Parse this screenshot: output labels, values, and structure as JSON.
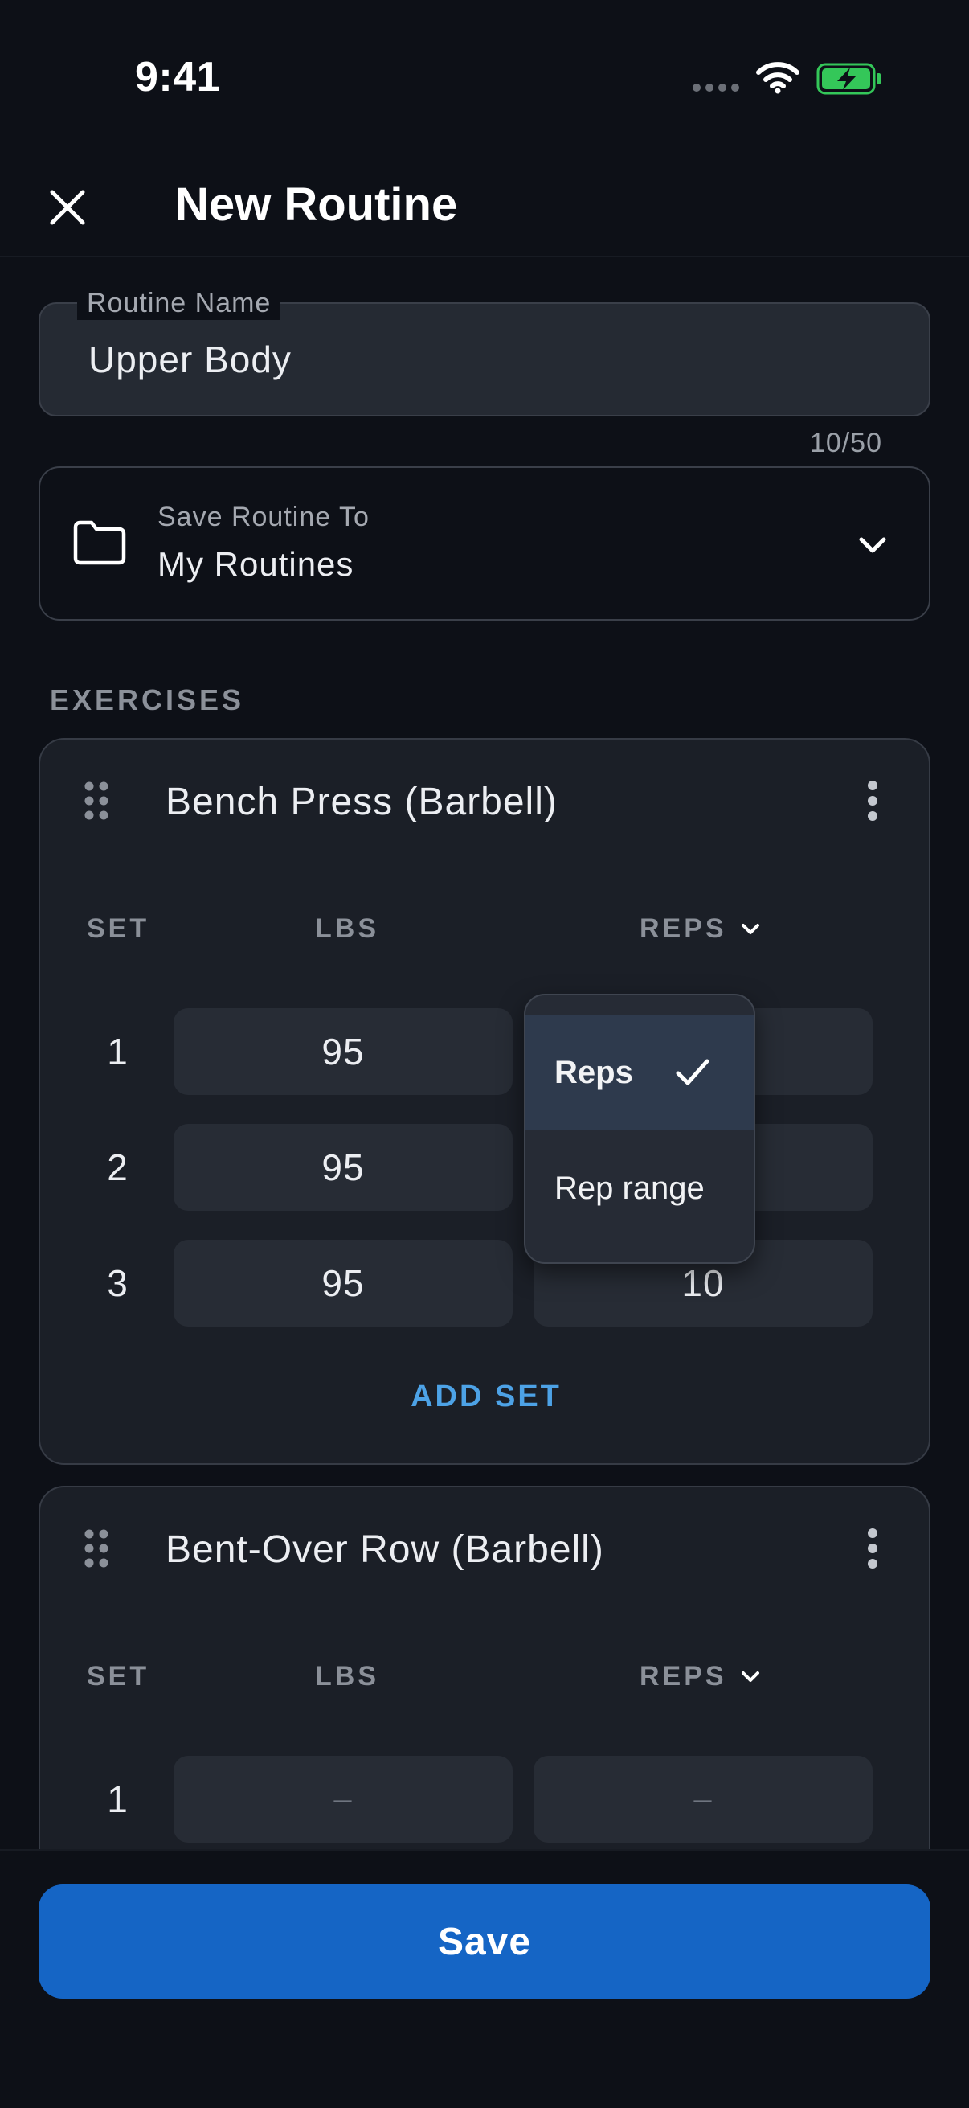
{
  "status_bar": {
    "time": "9:41"
  },
  "header": {
    "title": "New Routine"
  },
  "routine_name": {
    "label": "Routine Name",
    "value": "Upper Body",
    "char_count": "10/50"
  },
  "save_to": {
    "label": "Save Routine To",
    "value": "My Routines"
  },
  "exercises_heading": "EXERCISES",
  "columns": {
    "set": "SET",
    "lbs": "LBS",
    "reps": "REPS"
  },
  "exercises": [
    {
      "name": "Bench Press (Barbell)",
      "sets": [
        {
          "set": "1",
          "lbs": "95",
          "reps": ""
        },
        {
          "set": "2",
          "lbs": "95",
          "reps": ""
        },
        {
          "set": "3",
          "lbs": "95",
          "reps": "10"
        }
      ],
      "add_set": "ADD SET"
    },
    {
      "name": "Bent-Over Row (Barbell)",
      "sets": [
        {
          "set": "1",
          "lbs": "–",
          "reps": "–"
        }
      ]
    }
  ],
  "reps_menu": {
    "options": [
      "Reps",
      "Rep range"
    ],
    "selected": "Reps"
  },
  "bottom": {
    "save_label": "Save"
  },
  "colors": {
    "accent": "#1565c5",
    "link": "#4da2e6",
    "battery": "#34c759",
    "background": "#0d1017"
  }
}
